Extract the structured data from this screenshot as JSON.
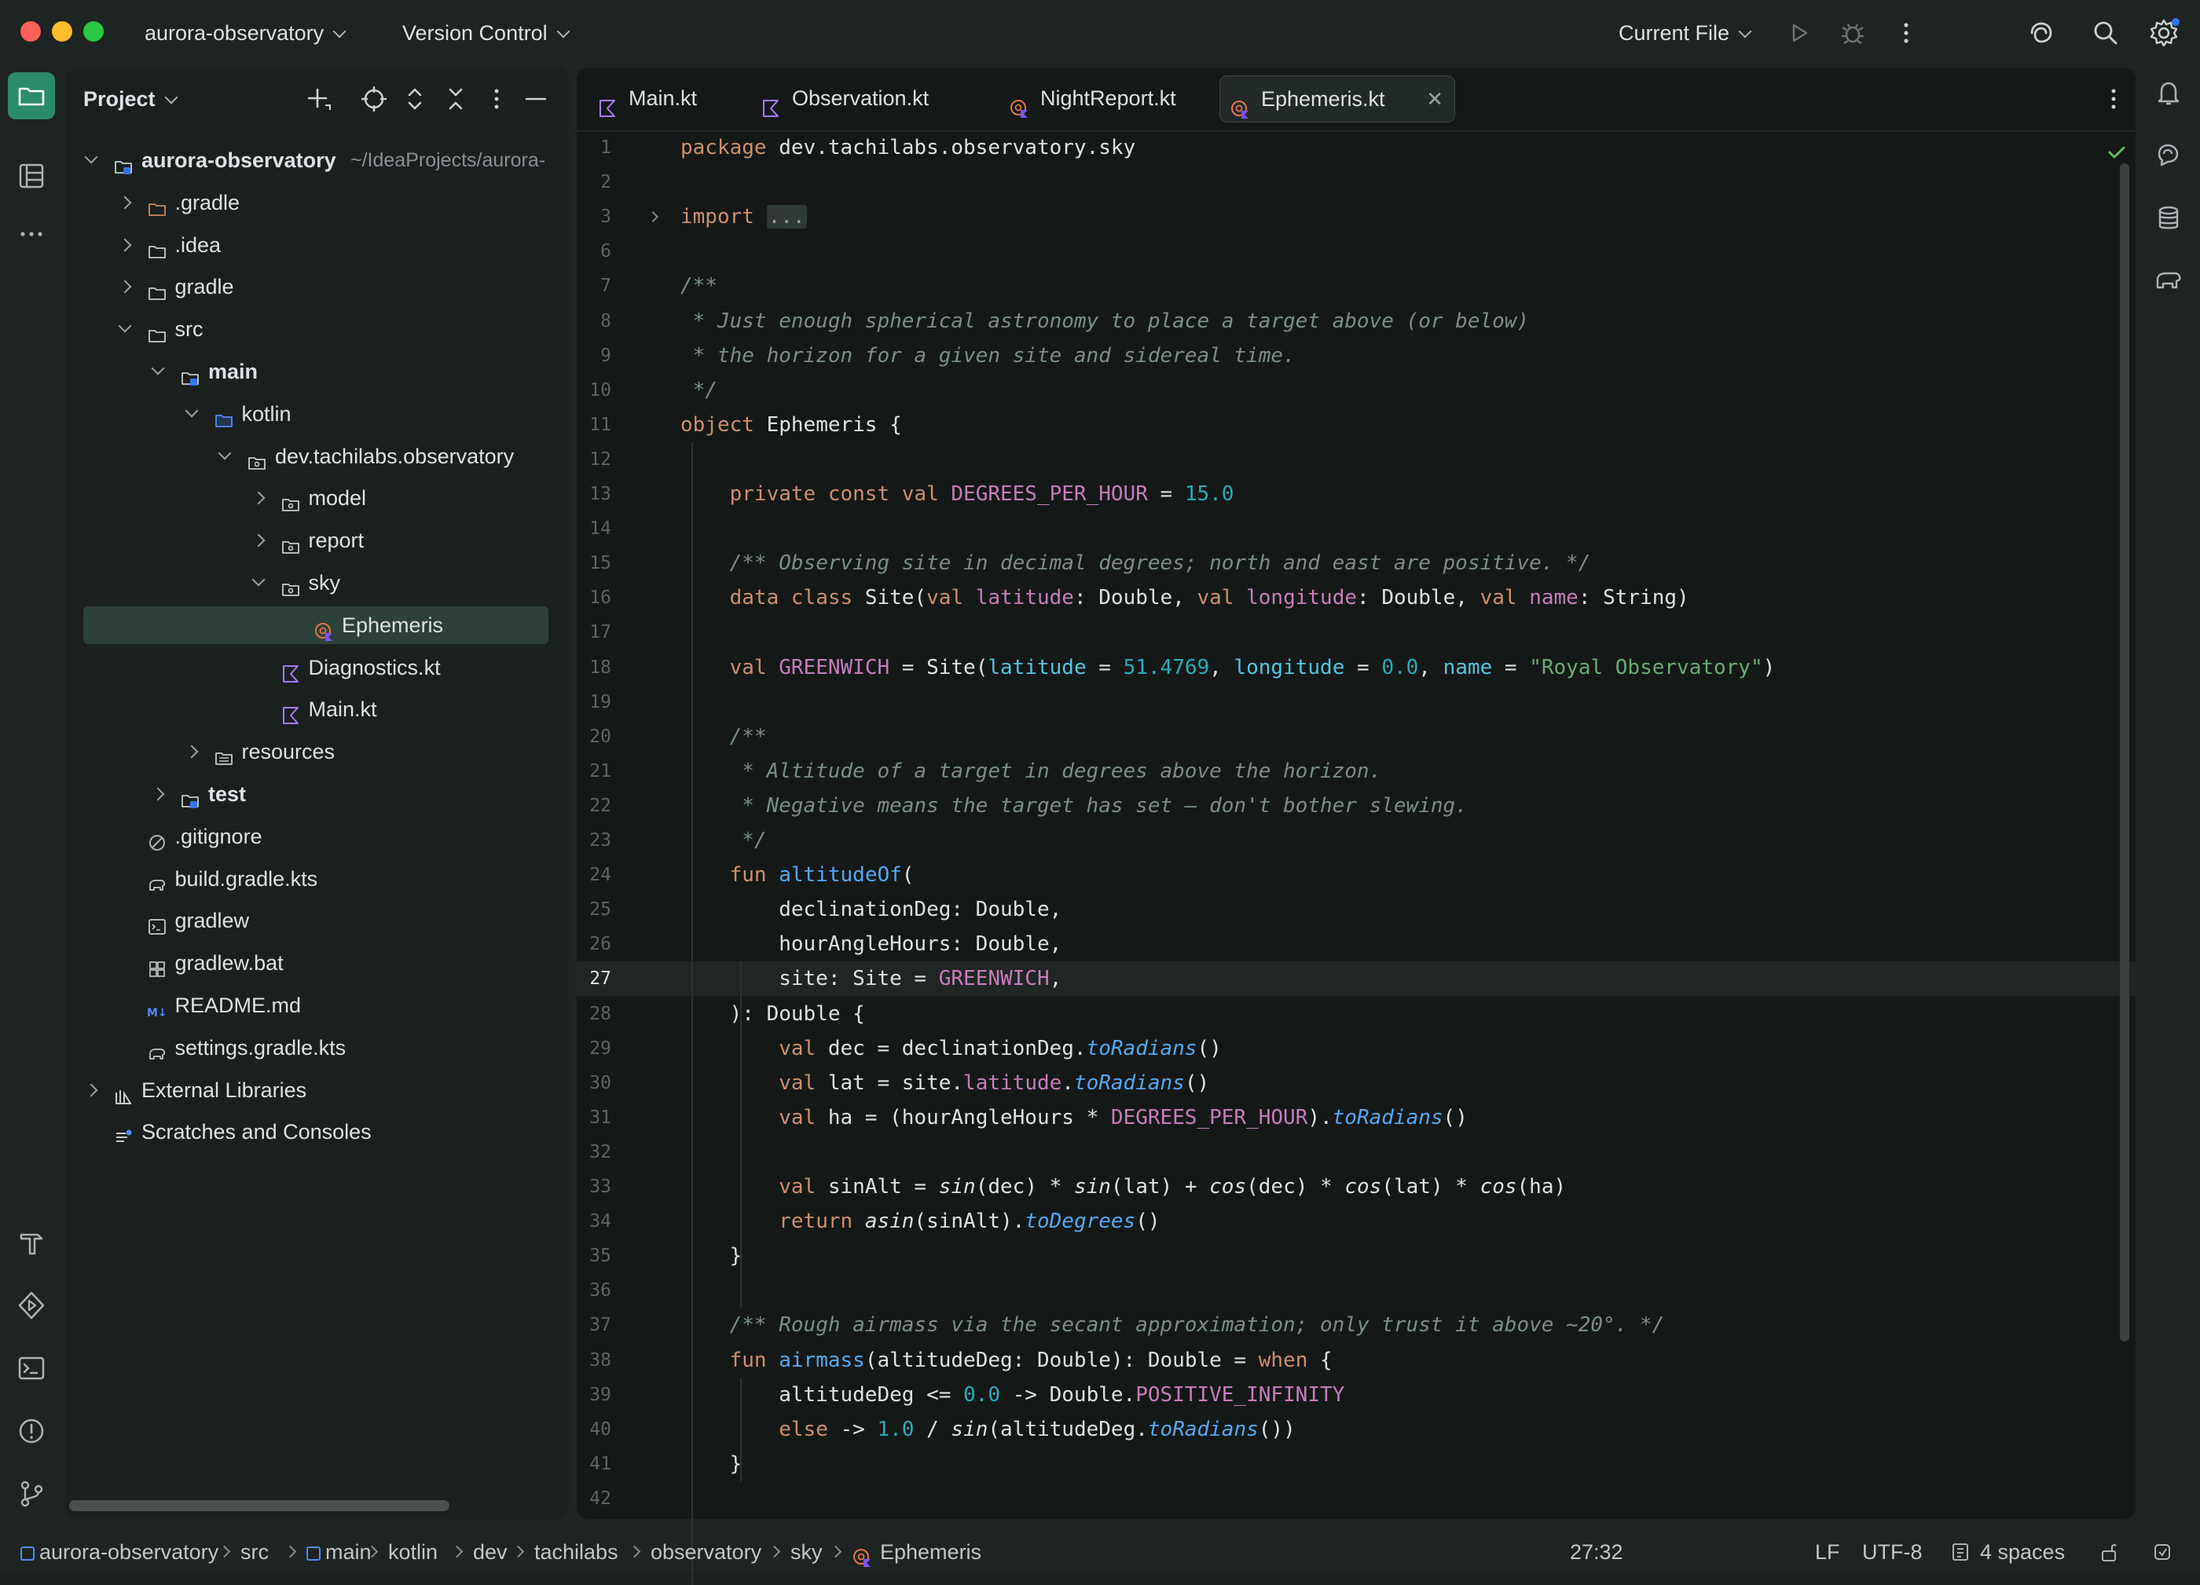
{
  "titlebar": {
    "project": "aurora-observatory",
    "vcs": "Version Control",
    "run_config": "Current File"
  },
  "project_panel": {
    "title": "Project",
    "tree": [
      {
        "label": "aurora-observatory",
        "hint": "~/IdeaProjects/aurora-",
        "bold": true,
        "depth": 0,
        "open": true,
        "icon": "module-folder-icon"
      },
      {
        "label": ".gradle",
        "depth": 1,
        "open": false,
        "icon": "folder-excluded-icon"
      },
      {
        "label": ".idea",
        "depth": 1,
        "open": false,
        "icon": "folder-icon"
      },
      {
        "label": "gradle",
        "depth": 1,
        "open": false,
        "icon": "folder-icon"
      },
      {
        "label": "src",
        "depth": 1,
        "open": true,
        "icon": "folder-icon"
      },
      {
        "label": "main",
        "bold": true,
        "depth": 2,
        "open": true,
        "icon": "module-folder-icon"
      },
      {
        "label": "kotlin",
        "depth": 3,
        "open": true,
        "icon": "source-folder-icon"
      },
      {
        "label": "dev.tachilabs.observatory",
        "depth": 4,
        "open": true,
        "icon": "package-icon"
      },
      {
        "label": "model",
        "depth": 5,
        "open": false,
        "icon": "package-icon"
      },
      {
        "label": "report",
        "depth": 5,
        "open": false,
        "icon": "package-icon"
      },
      {
        "label": "sky",
        "depth": 5,
        "open": true,
        "icon": "package-icon"
      },
      {
        "label": "Ephemeris",
        "depth": 6,
        "icon": "kotlin-object-icon",
        "selected": true
      },
      {
        "label": "Diagnostics.kt",
        "depth": 5,
        "icon": "kotlin-file-icon"
      },
      {
        "label": "Main.kt",
        "depth": 5,
        "icon": "kotlin-file-icon"
      },
      {
        "label": "resources",
        "depth": 3,
        "open": false,
        "icon": "resources-folder-icon"
      },
      {
        "label": "test",
        "bold": true,
        "depth": 2,
        "open": false,
        "icon": "module-folder-icon"
      },
      {
        "label": ".gitignore",
        "depth": 1,
        "icon": "ignore-file-icon"
      },
      {
        "label": "build.gradle.kts",
        "depth": 1,
        "icon": "gradle-icon"
      },
      {
        "label": "gradlew",
        "depth": 1,
        "icon": "shell-script-icon"
      },
      {
        "label": "gradlew.bat",
        "depth": 1,
        "icon": "windows-script-icon"
      },
      {
        "label": "README.md",
        "depth": 1,
        "icon": "markdown-icon"
      },
      {
        "label": "settings.gradle.kts",
        "depth": 1,
        "icon": "gradle-icon"
      },
      {
        "label": "External Libraries",
        "depth": 0,
        "open": false,
        "icon": "libraries-icon"
      },
      {
        "label": "Scratches and Consoles",
        "depth": 0,
        "icon": "scratches-icon"
      }
    ]
  },
  "tabs": [
    {
      "label": "Main.kt",
      "icon": "kotlin-file-icon"
    },
    {
      "label": "Observation.kt",
      "icon": "kotlin-file-icon"
    },
    {
      "label": "NightReport.kt",
      "icon": "kotlin-object-icon"
    },
    {
      "label": "Ephemeris.kt",
      "icon": "kotlin-object-icon",
      "active": true
    }
  ],
  "editor": {
    "current_line": 27,
    "lines": [
      {
        "n": 1,
        "html": "<span class='kw'>package</span> dev.tachilabs.observatory.sky"
      },
      {
        "n": 2,
        "html": ""
      },
      {
        "n": 3,
        "html": "<span class='kw'>import</span> <span class='fold'>...</span>",
        "fold": true
      },
      {
        "n": 6,
        "html": ""
      },
      {
        "n": 7,
        "html": "<span class='cm'>/**</span>"
      },
      {
        "n": 8,
        "html": "<span class='cm'> * Just enough spherical astronomy to place a target above (or below)</span>"
      },
      {
        "n": 9,
        "html": "<span class='cm'> * the horizon for a given site and sidereal time.</span>"
      },
      {
        "n": 10,
        "html": "<span class='cm'> */</span>"
      },
      {
        "n": 11,
        "html": "<span class='kw'>object</span> Ephemeris {"
      },
      {
        "n": 12,
        "html": ""
      },
      {
        "n": 13,
        "html": "    <span class='kw'>private const val</span> <span class='cn'>DEGREES_PER_HOUR</span> = <span class='num'>15.0</span>"
      },
      {
        "n": 14,
        "html": ""
      },
      {
        "n": 15,
        "html": "    <span class='cm'>/** Observing site in decimal degrees; north and east are positive. */</span>"
      },
      {
        "n": 16,
        "html": "    <span class='kw'>data class</span> Site(<span class='kw'>val</span> <span class='cn'>latitude</span>: Double, <span class='kw'>val</span> <span class='cn'>longitude</span>: Double, <span class='kw'>val</span> <span class='cn'>name</span>: String)"
      },
      {
        "n": 17,
        "html": ""
      },
      {
        "n": 18,
        "html": "    <span class='kw'>val</span> <span class='cn'>GREENWICH</span> = Site(<span class='prm'>latitude</span> = <span class='num'>51.4769</span>, <span class='prm'>longitude</span> = <span class='num'>0.0</span>, <span class='prm'>name</span> = <span class='str'>\"Royal Observatory\"</span>)"
      },
      {
        "n": 19,
        "html": ""
      },
      {
        "n": 20,
        "html": "    <span class='cm'>/**</span>"
      },
      {
        "n": 21,
        "html": "<span class='cm'>     * Altitude of a target in degrees above the horizon.</span>"
      },
      {
        "n": 22,
        "html": "<span class='cm'>     * Negative means the target has set — don't bother slewing.</span>"
      },
      {
        "n": 23,
        "html": "<span class='cm'>     */</span>"
      },
      {
        "n": 24,
        "html": "    <span class='kw'>fun</span> <span class='fn'>altitudeOf</span>("
      },
      {
        "n": 25,
        "html": "        declinationDeg: Double,"
      },
      {
        "n": 26,
        "html": "        hourAngleHours: Double,"
      },
      {
        "n": 27,
        "html": "        site: Site = <span class='cn'>GREENWICH</span>,"
      },
      {
        "n": 28,
        "html": "    ): Double {"
      },
      {
        "n": 29,
        "html": "        <span class='kw'>val</span> dec = declinationDeg.<span class='fni'>toRadians</span>()"
      },
      {
        "n": 30,
        "html": "        <span class='kw'>val</span> lat = site.<span class='cn'>latitude</span>.<span class='fni'>toRadians</span>()"
      },
      {
        "n": 31,
        "html": "        <span class='kw'>val</span> ha = (hourAngleHours * <span class='cn'>DEGREES_PER_HOUR</span>).<span class='fni'>toRadians</span>()"
      },
      {
        "n": 32,
        "html": ""
      },
      {
        "n": 33,
        "html": "        <span class='kw'>val</span> sinAlt = <span class='it'>sin</span>(dec) * <span class='it'>sin</span>(lat) + <span class='it'>cos</span>(dec) * <span class='it'>cos</span>(lat) * <span class='it'>cos</span>(ha)"
      },
      {
        "n": 34,
        "html": "        <span class='kw'>return</span> <span class='it'>asin</span>(sinAlt).<span class='fni'>toDegrees</span>()"
      },
      {
        "n": 35,
        "html": "    }"
      },
      {
        "n": 36,
        "html": ""
      },
      {
        "n": 37,
        "html": "    <span class='cm'>/** Rough airmass via the secant approximation; only trust it above ~20°. */</span>"
      },
      {
        "n": 38,
        "html": "    <span class='kw'>fun</span> <span class='fn'>airmass</span>(altitudeDeg: Double): Double = <span class='kw'>when</span> {"
      },
      {
        "n": 39,
        "html": "        altitudeDeg <= <span class='num'>0.0</span> -> Double.<span class='cn'>POSITIVE_INFINITY</span>"
      },
      {
        "n": 40,
        "html": "        <span class='kw'>else</span> -> <span class='num'>1.0</span> / <span class='it'>sin</span>(altitudeDeg.<span class='fni'>toRadians</span>())"
      },
      {
        "n": 41,
        "html": "    }"
      },
      {
        "n": 42,
        "html": ""
      }
    ]
  },
  "statusbar": {
    "breadcrumbs": [
      "aurora-observatory",
      "src",
      "main",
      "kotlin",
      "dev",
      "tachilabs",
      "observatory",
      "sky",
      "Ephemeris"
    ],
    "position": "27:32",
    "line_sep": "LF",
    "encoding": "UTF-8",
    "indent": "4 spaces"
  },
  "colors": {
    "accent": "#3574f0",
    "selection": "#2c4139",
    "keyword": "#cf8e6d",
    "comment": "#7a8f86",
    "number": "#2aacb8",
    "string": "#6aab73",
    "constant": "#c77dbb",
    "function": "#56a8f5"
  }
}
